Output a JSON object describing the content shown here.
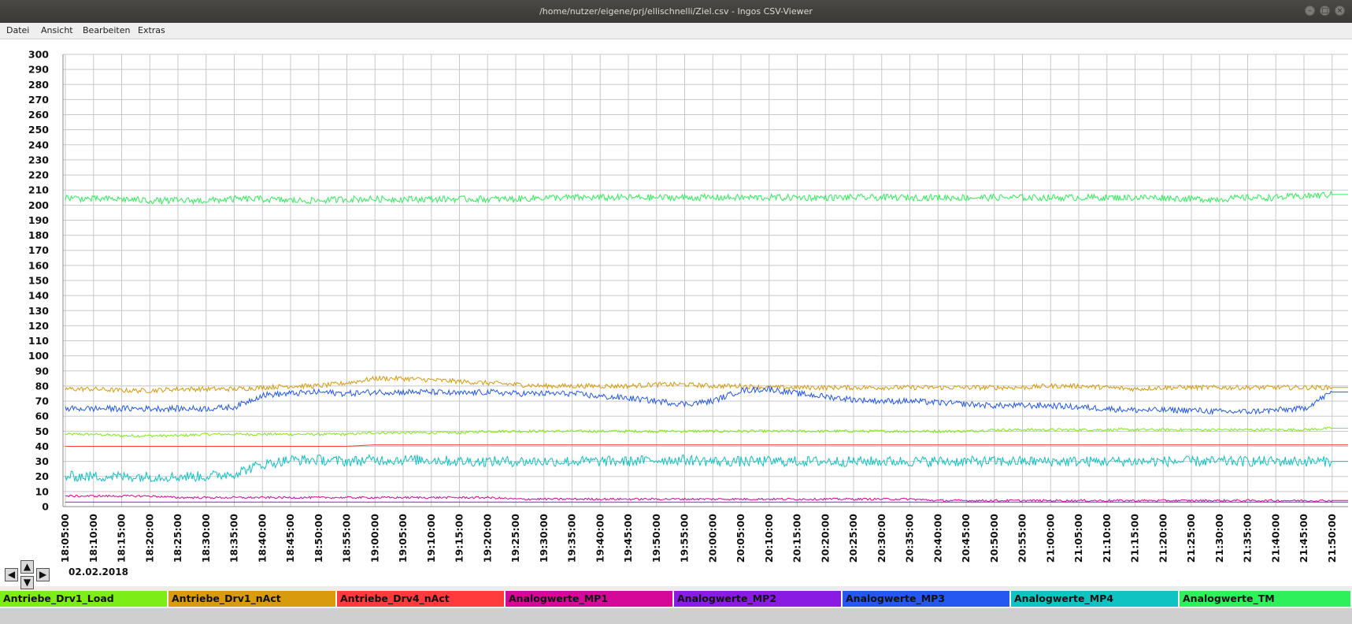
{
  "window": {
    "title": "/home/nutzer/eigene/prj/ellischnelli/Ziel.csv - Ingos CSV-Viewer"
  },
  "menu": [
    "Datei",
    "Ansicht",
    "Bearbeiten",
    "Extras"
  ],
  "date_label": "02.02.2018",
  "legend": [
    {
      "name": "Antriebe_Drv1_Load",
      "color": "#7ded17"
    },
    {
      "name": "Antriebe_Drv1_nAct",
      "color": "#d99a0e"
    },
    {
      "name": "Antriebe_Drv4_nAct",
      "color": "#ff3b3b"
    },
    {
      "name": "Analogwerte_MP1",
      "color": "#d6089a"
    },
    {
      "name": "Analogwerte_MP2",
      "color": "#8a1be3"
    },
    {
      "name": "Analogwerte_MP3",
      "color": "#2458f0"
    },
    {
      "name": "Analogwerte_MP4",
      "color": "#0fc3c3"
    },
    {
      "name": "Analogwerte_TM",
      "color": "#2ef05a"
    }
  ],
  "chart_data": {
    "type": "line",
    "grid": true,
    "ylim": [
      0,
      300
    ],
    "yticks": [
      0,
      10,
      20,
      30,
      40,
      50,
      60,
      70,
      80,
      90,
      100,
      110,
      120,
      130,
      140,
      150,
      160,
      170,
      180,
      190,
      200,
      210,
      220,
      230,
      240,
      250,
      260,
      270,
      280,
      290,
      300
    ],
    "x": [
      "18:05:00",
      "18:10:00",
      "18:15:00",
      "18:20:00",
      "18:25:00",
      "18:30:00",
      "18:35:00",
      "18:40:00",
      "18:45:00",
      "18:50:00",
      "18:55:00",
      "19:00:00",
      "19:05:00",
      "19:10:00",
      "19:15:00",
      "19:20:00",
      "19:25:00",
      "19:30:00",
      "19:35:00",
      "19:40:00",
      "19:45:00",
      "19:50:00",
      "19:55:00",
      "20:00:00",
      "20:05:00",
      "20:10:00",
      "20:15:00",
      "20:20:00",
      "20:25:00",
      "20:30:00",
      "20:35:00",
      "20:40:00",
      "20:45:00",
      "20:50:00",
      "20:55:00",
      "21:00:00",
      "21:05:00",
      "21:10:00",
      "21:15:00",
      "21:20:00",
      "21:25:00",
      "21:30:00",
      "21:35:00",
      "21:40:00",
      "21:45:00",
      "21:50:00"
    ],
    "series": [
      {
        "name": "Antriebe_Drv1_Load",
        "values": [
          48,
          48,
          47,
          47,
          47,
          48,
          48,
          48,
          48,
          48,
          48,
          49,
          49,
          49,
          49,
          50,
          50,
          50,
          50,
          50,
          50,
          50,
          50,
          50,
          50,
          50,
          50,
          50,
          50,
          50,
          50,
          50,
          50,
          51,
          51,
          51,
          51,
          51,
          51,
          51,
          51,
          51,
          51,
          51,
          51,
          52
        ]
      },
      {
        "name": "Antriebe_Drv1_nAct",
        "values": [
          78,
          78,
          77,
          77,
          78,
          78,
          78,
          79,
          80,
          80,
          82,
          85,
          85,
          84,
          83,
          82,
          81,
          80,
          80,
          80,
          80,
          81,
          81,
          80,
          80,
          79,
          79,
          79,
          79,
          79,
          79,
          79,
          79,
          79,
          79,
          80,
          80,
          79,
          78,
          79,
          79,
          79,
          79,
          79,
          79,
          79
        ]
      },
      {
        "name": "Antriebe_Drv4_nAct",
        "values": [
          40,
          40,
          40,
          40,
          40,
          40,
          40,
          40,
          40,
          40,
          40,
          41,
          41,
          41,
          41,
          41,
          41,
          41,
          41,
          41,
          41,
          41,
          41,
          41,
          41,
          41,
          41,
          41,
          41,
          41,
          41,
          41,
          41,
          41,
          41,
          41,
          41,
          41,
          41,
          41,
          41,
          41,
          41,
          41,
          41,
          41
        ]
      },
      {
        "name": "Analogwerte_MP1",
        "values": [
          7,
          7,
          7,
          7,
          6,
          6,
          6,
          6,
          6,
          6,
          6,
          6,
          6,
          6,
          6,
          6,
          5,
          5,
          5,
          5,
          5,
          5,
          5,
          5,
          5,
          5,
          5,
          5,
          5,
          5,
          5,
          4,
          4,
          4,
          4,
          4,
          4,
          4,
          4,
          4,
          4,
          4,
          4,
          4,
          4,
          4
        ]
      },
      {
        "name": "Analogwerte_MP2",
        "values": [
          3,
          3,
          3,
          3,
          3,
          3,
          3,
          3,
          3,
          3,
          3,
          3,
          3,
          3,
          3,
          3,
          3,
          3,
          3,
          3,
          3,
          3,
          3,
          3,
          3,
          3,
          3,
          3,
          3,
          3,
          3,
          3,
          3,
          3,
          3,
          3,
          3,
          3,
          3,
          3,
          3,
          3,
          3,
          3,
          3,
          3
        ]
      },
      {
        "name": "Analogwerte_MP3",
        "values": [
          65,
          65,
          65,
          65,
          65,
          65,
          66,
          74,
          75,
          76,
          75,
          76,
          76,
          76,
          75,
          76,
          75,
          75,
          75,
          73,
          72,
          70,
          68,
          70,
          77,
          78,
          75,
          73,
          71,
          70,
          70,
          69,
          68,
          67,
          67,
          67,
          66,
          65,
          64,
          64,
          64,
          63,
          63,
          64,
          65,
          76
        ]
      },
      {
        "name": "Analogwerte_MP4",
        "values": [
          20,
          20,
          20,
          20,
          20,
          20,
          22,
          28,
          31,
          31,
          30,
          31,
          31,
          31,
          30,
          30,
          30,
          30,
          30,
          30,
          30,
          31,
          31,
          30,
          30,
          30,
          30,
          30,
          30,
          30,
          30,
          30,
          30,
          30,
          30,
          30,
          30,
          30,
          30,
          30,
          30,
          30,
          30,
          30,
          30,
          30
        ]
      },
      {
        "name": "Analogwerte_TM",
        "values": [
          205,
          204,
          204,
          203,
          203,
          203,
          204,
          204,
          203,
          203,
          204,
          204,
          204,
          204,
          204,
          204,
          204,
          205,
          205,
          205,
          205,
          205,
          205,
          205,
          205,
          205,
          205,
          205,
          205,
          205,
          205,
          205,
          205,
          205,
          205,
          205,
          205,
          205,
          205,
          205,
          204,
          204,
          205,
          205,
          206,
          207
        ]
      }
    ]
  }
}
